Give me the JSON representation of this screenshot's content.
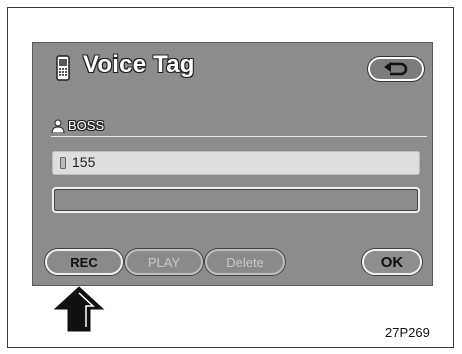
{
  "header": {
    "title": "Voice Tag",
    "phone_icon": "mobile-phone-icon",
    "back_icon": "return-arrow-icon"
  },
  "contact": {
    "name": "BOSS",
    "icon": "person-icon"
  },
  "fields": [
    {
      "value": "155",
      "icon": "small-phone-icon"
    },
    {
      "value": ""
    }
  ],
  "buttons": {
    "rec": "REC",
    "play": "PLAY",
    "delete": "Delete",
    "ok": "OK"
  },
  "caption": "27P269",
  "colors": {
    "screen": "#8c8c8c",
    "highlight_field": "#dedede",
    "text_light": "#ffffff"
  }
}
